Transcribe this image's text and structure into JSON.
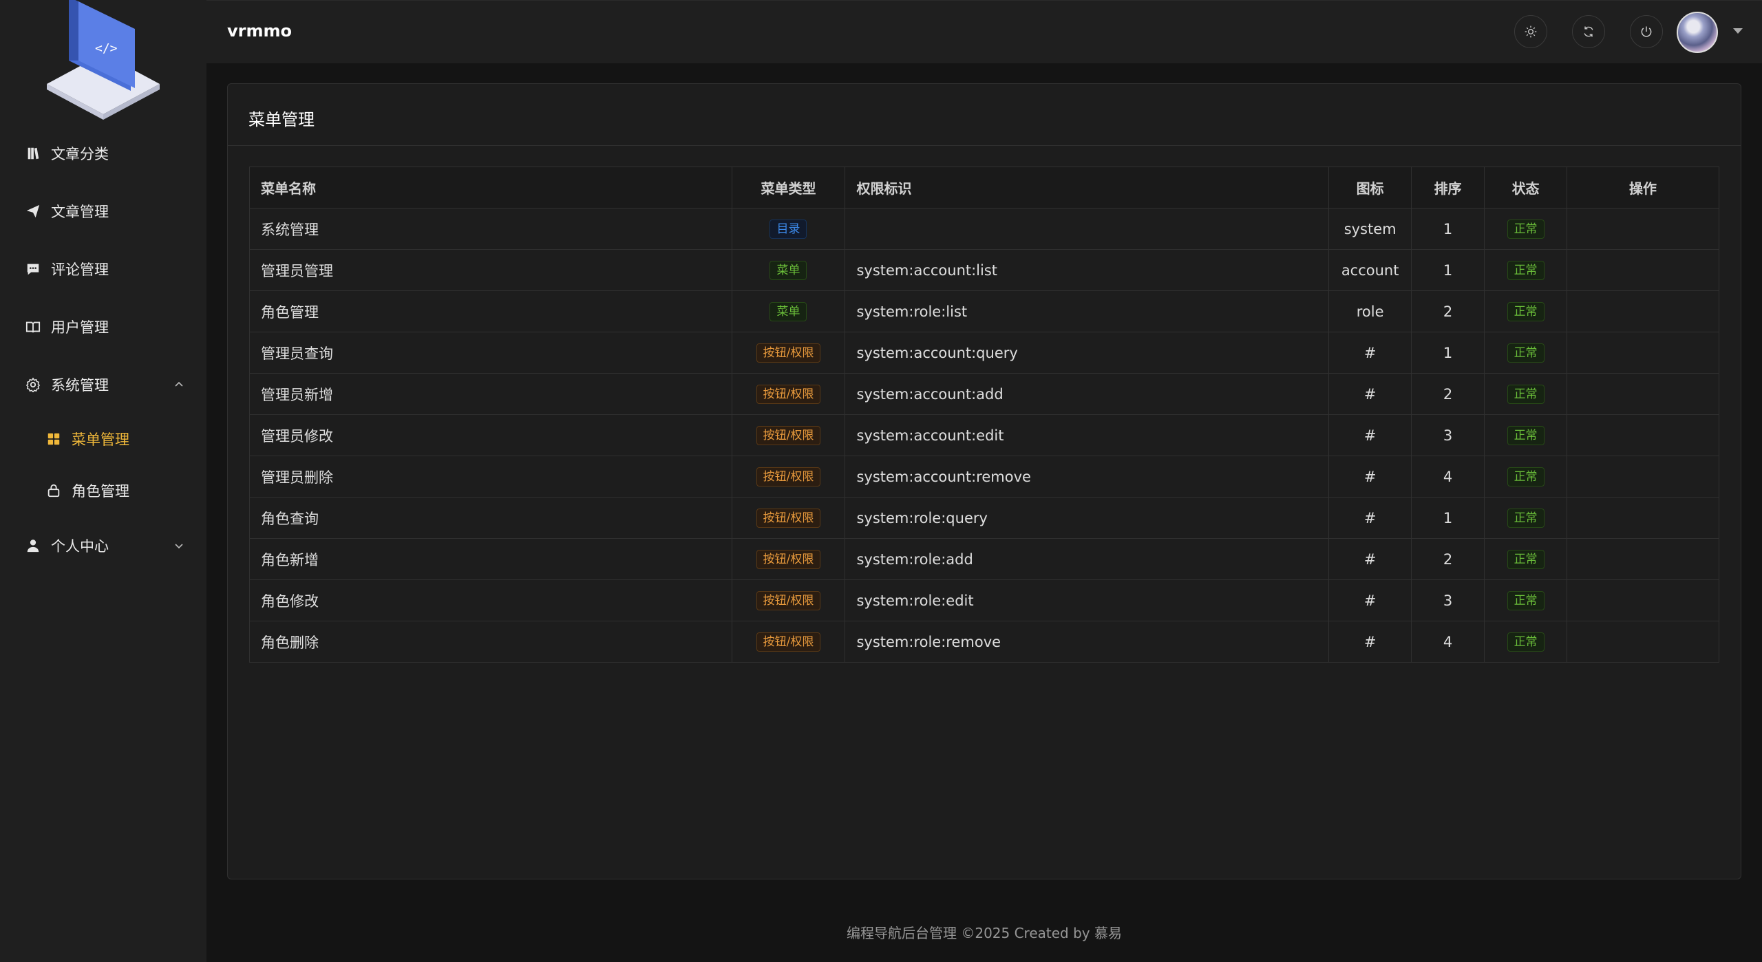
{
  "header": {
    "app_title": "vrmmo"
  },
  "sidebar": {
    "items": [
      {
        "label": "文章分类",
        "icon": "book-icon"
      },
      {
        "label": "文章管理",
        "icon": "send-icon"
      },
      {
        "label": "评论管理",
        "icon": "comment-icon"
      },
      {
        "label": "用户管理",
        "icon": "open-book-icon"
      },
      {
        "label": "系统管理",
        "icon": "gear-icon",
        "expanded": true
      },
      {
        "label": "菜单管理",
        "icon": "grid-icon",
        "active": true
      },
      {
        "label": "角色管理",
        "icon": "lock-icon"
      },
      {
        "label": "个人中心",
        "icon": "user-icon",
        "expanded": false
      }
    ]
  },
  "card": {
    "title": "菜单管理"
  },
  "table": {
    "headers": [
      "菜单名称",
      "菜单类型",
      "权限标识",
      "图标",
      "排序",
      "状态",
      "操作"
    ],
    "rows": [
      {
        "name": "系统管理",
        "type": "目录",
        "type_color": "blue",
        "perm": "",
        "icon": "system",
        "order": "1",
        "status": "正常"
      },
      {
        "name": "管理员管理",
        "type": "菜单",
        "type_color": "green",
        "perm": "system:account:list",
        "icon": "account",
        "order": "1",
        "status": "正常"
      },
      {
        "name": "角色管理",
        "type": "菜单",
        "type_color": "green",
        "perm": "system:role:list",
        "icon": "role",
        "order": "2",
        "status": "正常"
      },
      {
        "name": "管理员查询",
        "type": "按钮/权限",
        "type_color": "orange",
        "perm": "system:account:query",
        "icon": "#",
        "order": "1",
        "status": "正常"
      },
      {
        "name": "管理员新增",
        "type": "按钮/权限",
        "type_color": "orange",
        "perm": "system:account:add",
        "icon": "#",
        "order": "2",
        "status": "正常"
      },
      {
        "name": "管理员修改",
        "type": "按钮/权限",
        "type_color": "orange",
        "perm": "system:account:edit",
        "icon": "#",
        "order": "3",
        "status": "正常"
      },
      {
        "name": "管理员删除",
        "type": "按钮/权限",
        "type_color": "orange",
        "perm": "system:account:remove",
        "icon": "#",
        "order": "4",
        "status": "正常"
      },
      {
        "name": "角色查询",
        "type": "按钮/权限",
        "type_color": "orange",
        "perm": "system:role:query",
        "icon": "#",
        "order": "1",
        "status": "正常"
      },
      {
        "name": "角色新增",
        "type": "按钮/权限",
        "type_color": "orange",
        "perm": "system:role:add",
        "icon": "#",
        "order": "2",
        "status": "正常"
      },
      {
        "name": "角色修改",
        "type": "按钮/权限",
        "type_color": "orange",
        "perm": "system:role:edit",
        "icon": "#",
        "order": "3",
        "status": "正常"
      },
      {
        "name": "角色删除",
        "type": "按钮/权限",
        "type_color": "orange",
        "perm": "system:role:remove",
        "icon": "#",
        "order": "4",
        "status": "正常"
      }
    ]
  },
  "footer": {
    "text": "编程导航后台管理 ©2025 Created by 慕易"
  },
  "colors": {
    "accent": "#f0b83a",
    "background": "#141414",
    "panel": "#1f1f1f"
  }
}
